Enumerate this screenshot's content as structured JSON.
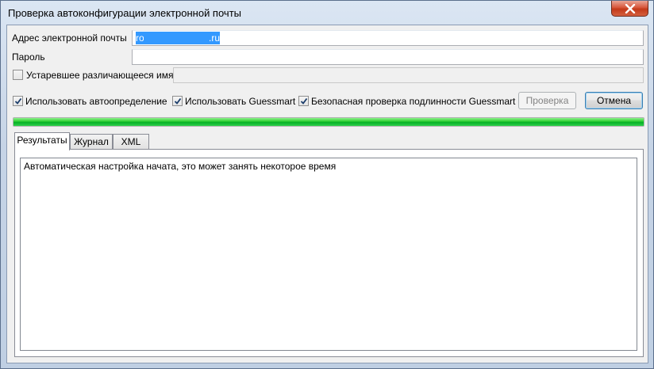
{
  "window": {
    "title": "Проверка автоконфигурации электронной почты"
  },
  "form": {
    "email_label": "Адрес электронной почты",
    "email_value_start": "ro",
    "email_value_end": ".ru",
    "password_label": "Пароль",
    "password_value": "",
    "legacy_label": "Устаревшее различающееся имя",
    "legacy_value": ""
  },
  "options": {
    "autodiscover_label": "Использовать автоопределение",
    "autodiscover_checked": true,
    "guessmart_label": "Использовать Guessmart",
    "guessmart_checked": true,
    "secure_auth_label": "Безопасная проверка подлинности Guessmart",
    "secure_auth_checked": true,
    "legacy_checked": false
  },
  "buttons": {
    "test_label": "Проверка",
    "cancel_label": "Отмена"
  },
  "progress": {
    "fraction": 1.0,
    "color": "#06b025"
  },
  "tabs": [
    {
      "label": "Результаты",
      "active": true
    },
    {
      "label": "Журнал",
      "active": false
    },
    {
      "label": "XML",
      "active": false
    }
  ],
  "results": {
    "text": "Автоматическая настройка начата, это может занять некоторое время"
  }
}
